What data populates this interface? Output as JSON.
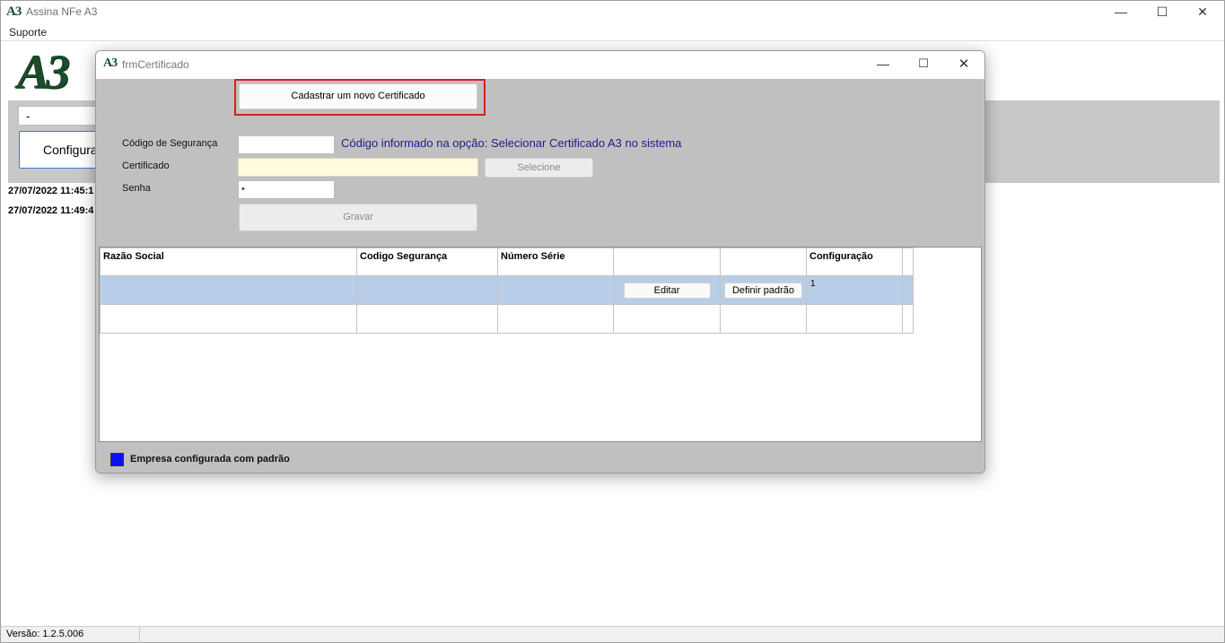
{
  "main_window": {
    "logo_text": "A3",
    "title": "Assina NFe A3",
    "menu": [
      "Suporte"
    ],
    "combo_value": "-",
    "config_button_label": "Configura",
    "log_lines": [
      "27/07/2022 11:45:1",
      "27/07/2022 11:49:4"
    ],
    "version_label": "Versão: 1.2.5.006"
  },
  "dialog": {
    "logo_text": "A3",
    "title": "frmCertificado",
    "new_cert_button": "Cadastrar um novo Certificado",
    "fields": {
      "codigo_label": "Código de Segurança",
      "codigo_value": "",
      "codigo_hint": "Código informado na opção: Selecionar Certificado A3 no sistema",
      "certificado_label": "Certificado",
      "certificado_value": "",
      "selecione_button": "Selecione",
      "senha_label": "Senha",
      "senha_value": "•",
      "gravar_button": "Gravar"
    },
    "grid": {
      "columns": [
        "Razão Social",
        "Codigo Segurança",
        "Número Série",
        "",
        "",
        "Configuração"
      ],
      "rows": [
        {
          "razao_social": "",
          "codigo": "",
          "numero_serie": "",
          "edit_label": "Editar",
          "default_label": "Definir padrão",
          "configuracao": "1"
        }
      ]
    },
    "legend": {
      "label": "Empresa configurada com padrão",
      "color": "#0a12f0"
    }
  },
  "colors": {
    "highlight_border": "#e01b1b",
    "selected_row": "#b8cde8",
    "hint_text": "#1c1c8c",
    "logo_green": "#1a4c2a"
  },
  "icons": {
    "minimize": "minimize-icon",
    "maximize": "maximize-icon",
    "close": "close-icon"
  }
}
